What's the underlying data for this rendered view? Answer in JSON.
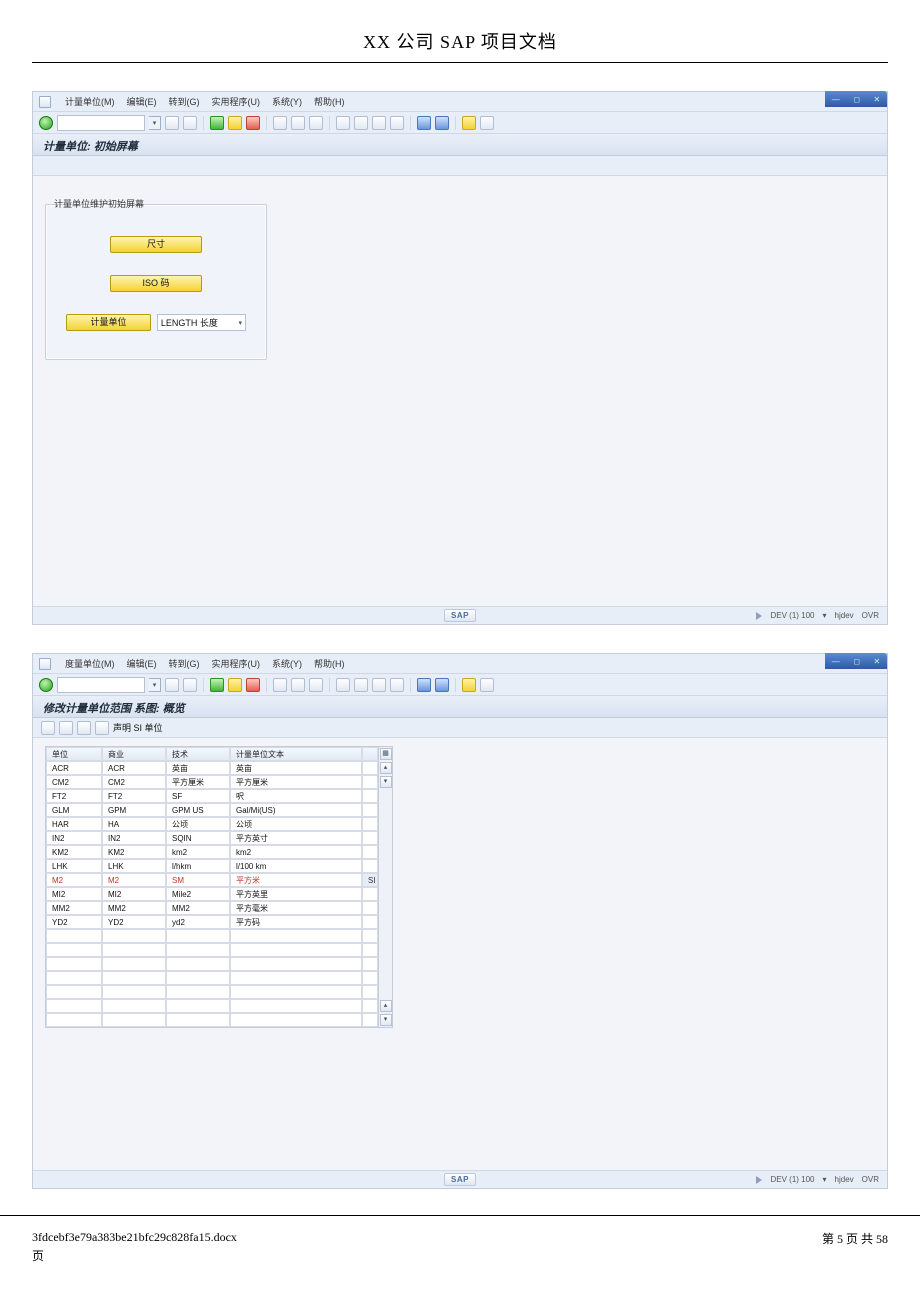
{
  "doc_title": "XX 公司 SAP 项目文档",
  "footer": {
    "filename": "3fdcebf3e79a383be21bfc29c828fa15.docx",
    "page_label": "第 5 页 共 58",
    "page_suffix": "页"
  },
  "win_controls": {
    "min": "—",
    "max": "◻",
    "close": "✕"
  },
  "screenshot1": {
    "menu": {
      "t1": "计量单位(M)",
      "t2": "编辑(E)",
      "t3": "转到(G)",
      "t4": "实用程序(U)",
      "t5": "系统(Y)",
      "t6": "帮助(H)"
    },
    "title": "计量单位: 初始屏幕",
    "panel_title": "计量单位维护初始屏幕",
    "btn_size": "尺寸",
    "btn_iso": "ISO 码",
    "btn_uom": "计量单位",
    "select_value": "LENGTH 长度",
    "status": {
      "system": "DEV (1) 100",
      "server": "hjdev",
      "mode": "OVR",
      "sap": "SAP"
    }
  },
  "screenshot2": {
    "menu": {
      "t1": "度量单位(M)",
      "t2": "编辑(E)",
      "t3": "转到(G)",
      "t4": "实用程序(U)",
      "t5": "系统(Y)",
      "t6": "帮助(H)"
    },
    "title": "修改计量单位范围 系图: 概览",
    "subbar_label": "声明 SI 单位",
    "headers": {
      "c0": "单位",
      "c1": "商业",
      "c2": "技术",
      "c3": "计量单位文本",
      "c4": ""
    },
    "rows": [
      {
        "c0": "ACR",
        "c1": "ACR",
        "c2": "英亩",
        "c3": "英亩",
        "c4": ""
      },
      {
        "c0": "CM2",
        "c1": "CM2",
        "c2": "平方厘米",
        "c3": "平方厘米",
        "c4": ""
      },
      {
        "c0": "FT2",
        "c1": "FT2",
        "c2": "SF",
        "c3": "呎",
        "c4": ""
      },
      {
        "c0": "GLM",
        "c1": "GPM",
        "c2": "GPM US",
        "c3": "Gal/Mi(US)",
        "c4": ""
      },
      {
        "c0": "HAR",
        "c1": "HA",
        "c2": "公顷",
        "c3": "公顷",
        "c4": ""
      },
      {
        "c0": "IN2",
        "c1": "IN2",
        "c2": "SQIN",
        "c3": "平方英寸",
        "c4": ""
      },
      {
        "c0": "KM2",
        "c1": "KM2",
        "c2": "km2",
        "c3": "km2",
        "c4": ""
      },
      {
        "c0": "LHK",
        "c1": "LHK",
        "c2": "l/hkm",
        "c3": "l/100 km",
        "c4": ""
      },
      {
        "c0": "M2",
        "c1": "M2",
        "c2": "SM",
        "c3": "平方米",
        "c4": "SI",
        "hl": true
      },
      {
        "c0": "MI2",
        "c1": "MI2",
        "c2": "Mile2",
        "c3": "平方英里",
        "c4": ""
      },
      {
        "c0": "MM2",
        "c1": "MM2",
        "c2": "MM2",
        "c3": "平方毫米",
        "c4": ""
      },
      {
        "c0": "YD2",
        "c1": "YD2",
        "c2": "yd2",
        "c3": "平方码",
        "c4": ""
      }
    ],
    "empty_rows": 7,
    "status": {
      "system": "DEV (1) 100",
      "server": "hjdev",
      "mode": "OVR",
      "sap": "SAP"
    }
  }
}
